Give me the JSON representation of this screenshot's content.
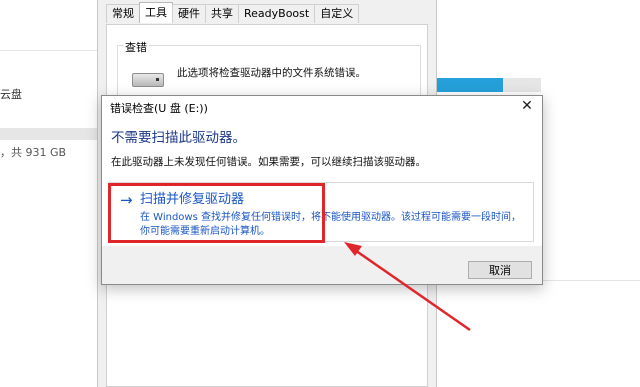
{
  "background": {
    "drive_label": "云盘",
    "size_text": "，共 931 GB"
  },
  "properties": {
    "tabs": [
      {
        "label": "常规"
      },
      {
        "label": "工具"
      },
      {
        "label": "硬件"
      },
      {
        "label": "共享"
      },
      {
        "label": "ReadyBoost"
      },
      {
        "label": "自定义"
      }
    ],
    "active_tab": "工具",
    "group_label": "查错",
    "group_text": "此选项将检查驱动器中的文件系统错误。"
  },
  "dialog": {
    "title": "错误检查(U 盘 (E:))",
    "close_glyph": "✕",
    "heading": "不需要扫描此驱动器。",
    "description": "在此驱动器上未发现任何错误。如果需要，可以继续扫描该驱动器。",
    "command": {
      "arrow_glyph": "→",
      "title": "扫描并修复驱动器",
      "description": "在 Windows 查找并修复任何错误时，将不能使用驱动器。该过程可能需要一段时间，你可能需要重新启动计算机。"
    },
    "cancel_label": "取消"
  },
  "annotation": {
    "color": "#e0262b",
    "link_color": "#1a56c4"
  }
}
